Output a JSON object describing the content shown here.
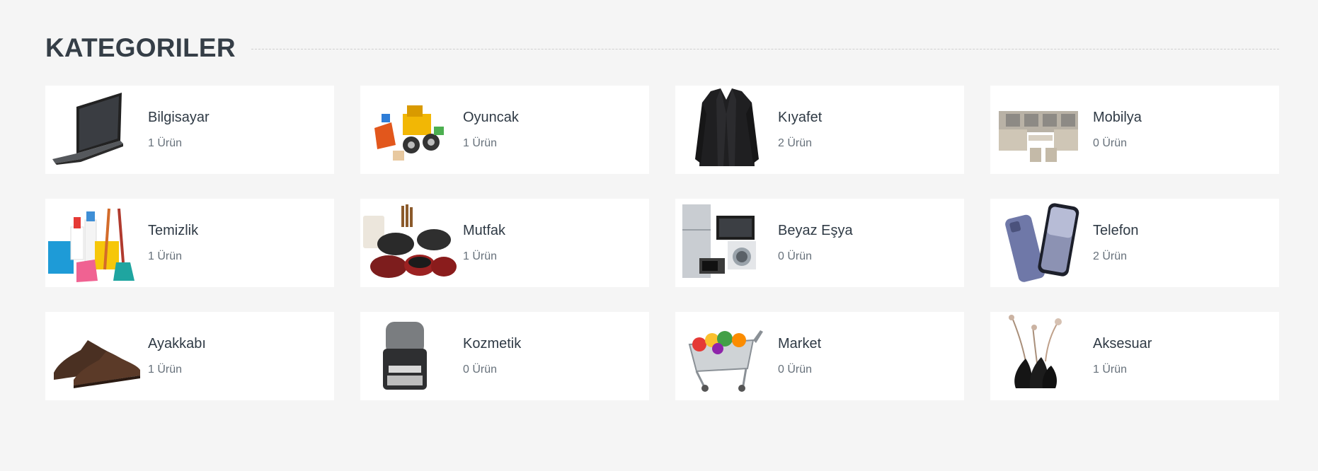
{
  "section": {
    "title": "KATEGORILER"
  },
  "categories": [
    {
      "name": "Bilgisayar",
      "count": "1 Ürün",
      "icon": "laptop-icon"
    },
    {
      "name": "Oyuncak",
      "count": "1 Ürün",
      "icon": "toy-bulldozer-icon"
    },
    {
      "name": "Kıyafet",
      "count": "2 Ürün",
      "icon": "jacket-icon"
    },
    {
      "name": "Mobilya",
      "count": "0 Ürün",
      "icon": "sofa-set-icon"
    },
    {
      "name": "Temizlik",
      "count": "1 Ürün",
      "icon": "cleaning-supplies-icon"
    },
    {
      "name": "Mutfak",
      "count": "1 Ürün",
      "icon": "cookware-icon"
    },
    {
      "name": "Beyaz Eşya",
      "count": "0 Ürün",
      "icon": "appliances-icon"
    },
    {
      "name": "Telefon",
      "count": "2 Ürün",
      "icon": "smartphone-icon"
    },
    {
      "name": "Ayakkabı",
      "count": "1 Ürün",
      "icon": "shoes-icon"
    },
    {
      "name": "Kozmetik",
      "count": "0 Ürün",
      "icon": "perfume-bottle-icon"
    },
    {
      "name": "Market",
      "count": "0 Ürün",
      "icon": "shopping-cart-icon"
    },
    {
      "name": "Aksesuar",
      "count": "1 Ürün",
      "icon": "vase-decor-icon"
    }
  ]
}
